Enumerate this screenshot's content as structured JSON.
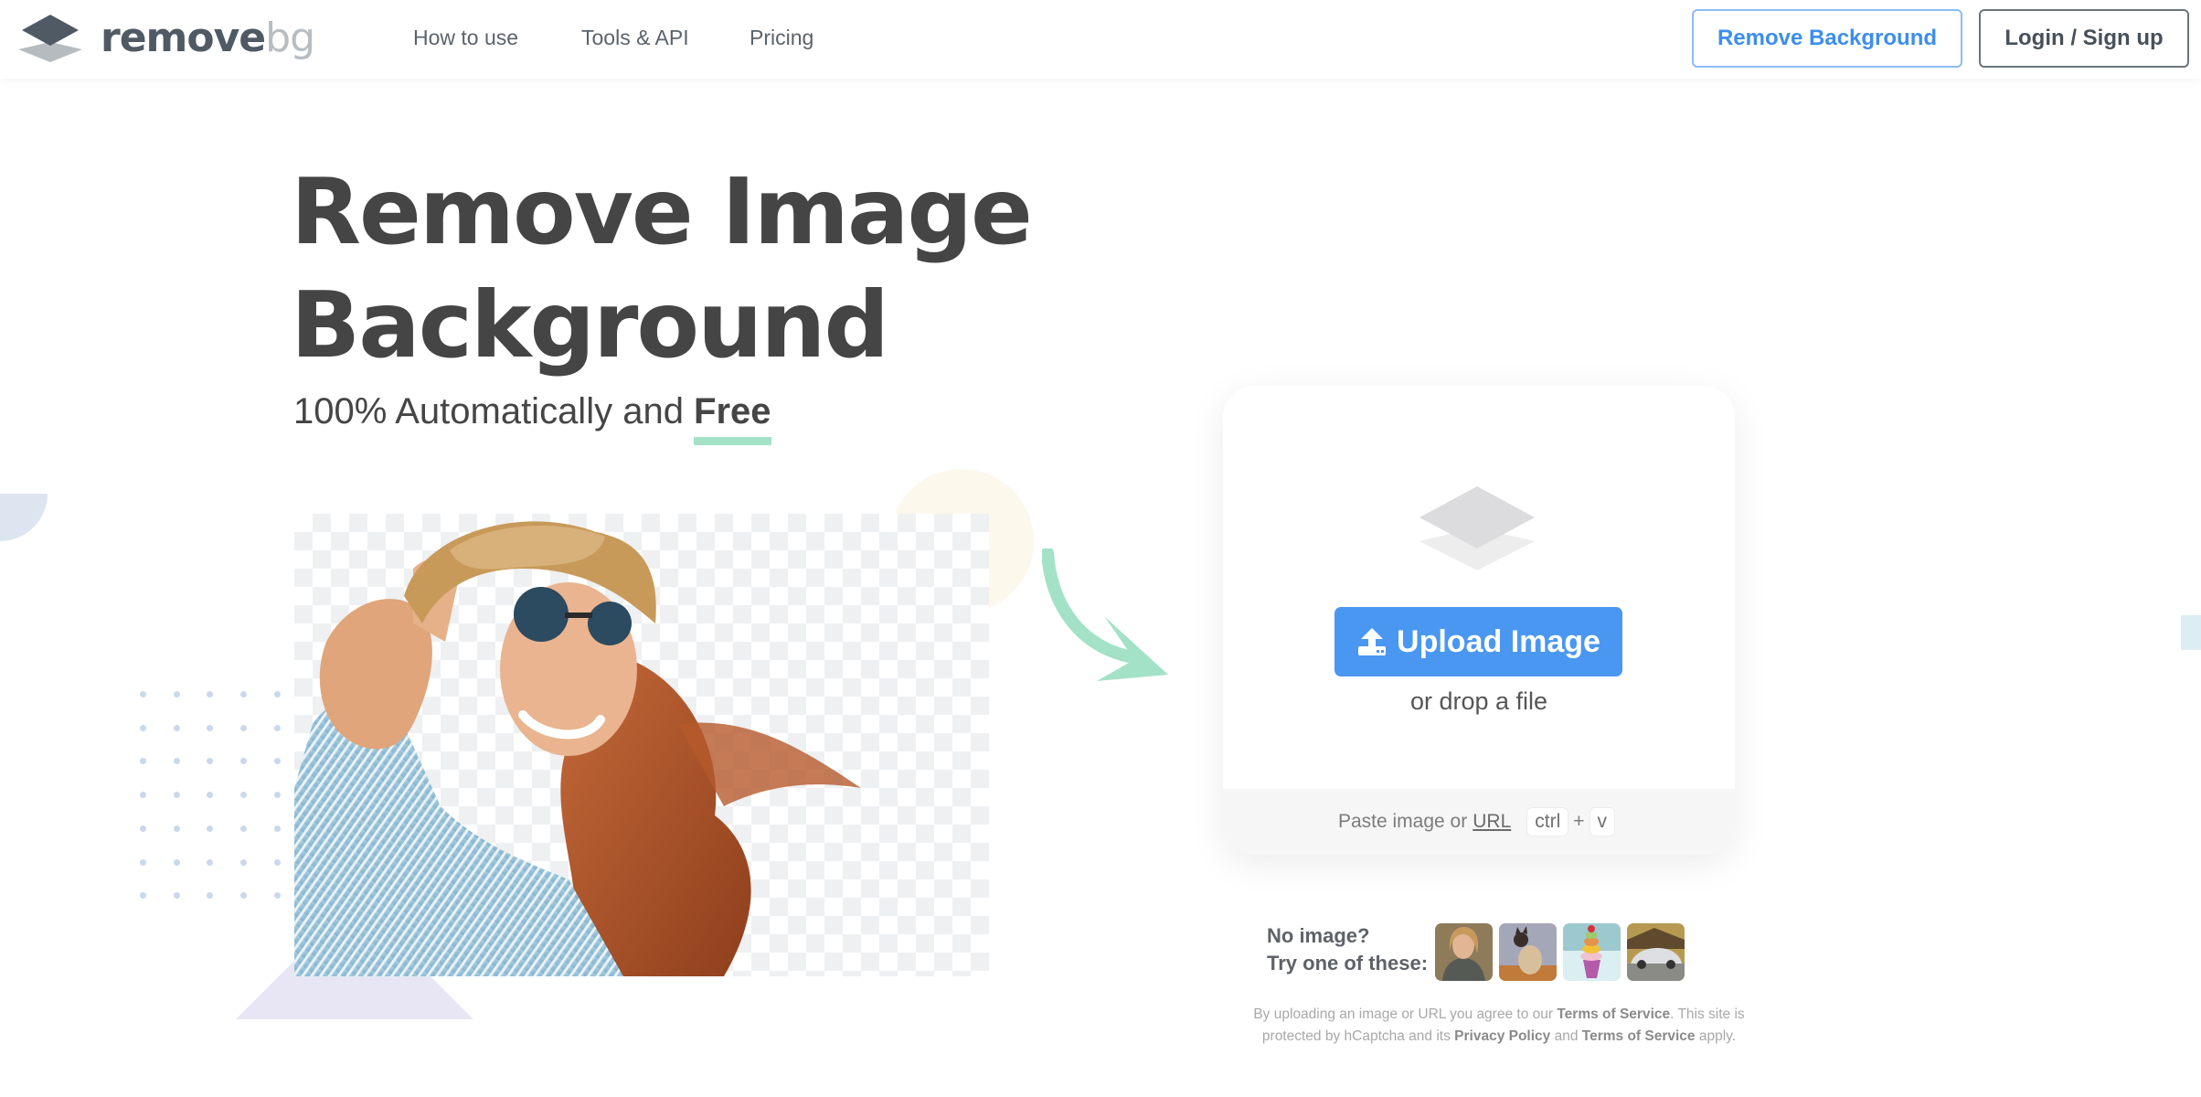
{
  "header": {
    "logo_text_main": "remove",
    "logo_text_accent": "bg",
    "nav": [
      {
        "label": "How to use"
      },
      {
        "label": "Tools & API"
      },
      {
        "label": "Pricing"
      }
    ],
    "cta_remove_background": "Remove Background",
    "cta_login": "Login / Sign up"
  },
  "hero": {
    "title_line1": "Remove Image",
    "title_line2": "Background",
    "subtitle_prefix": "100% Automatically and ",
    "subtitle_emphasis": "Free"
  },
  "upload_card": {
    "upload_button": "Upload Image",
    "drop_text": "or drop a file",
    "paste_text": "Paste image or",
    "url_link": "URL",
    "shortcut_key1": "ctrl",
    "shortcut_plus": "+",
    "shortcut_key2": "v"
  },
  "samples": {
    "line1": "No image?",
    "line2": "Try one of these:",
    "items": [
      {
        "name": "woman"
      },
      {
        "name": "cat"
      },
      {
        "name": "ice cream"
      },
      {
        "name": "car"
      }
    ]
  },
  "legal": {
    "part1": "By uploading an image or URL you agree to our ",
    "terms1": "Terms of Service",
    "part2": ". This site is protected by hCaptcha and its ",
    "privacy": "Privacy Policy",
    "part3": " and ",
    "terms2": "Terms of Service",
    "part4": " apply."
  },
  "colors": {
    "brand_dark": "#4f5a64",
    "accent_blue": "#4a97f2",
    "accent_green": "#a3e2c6"
  }
}
